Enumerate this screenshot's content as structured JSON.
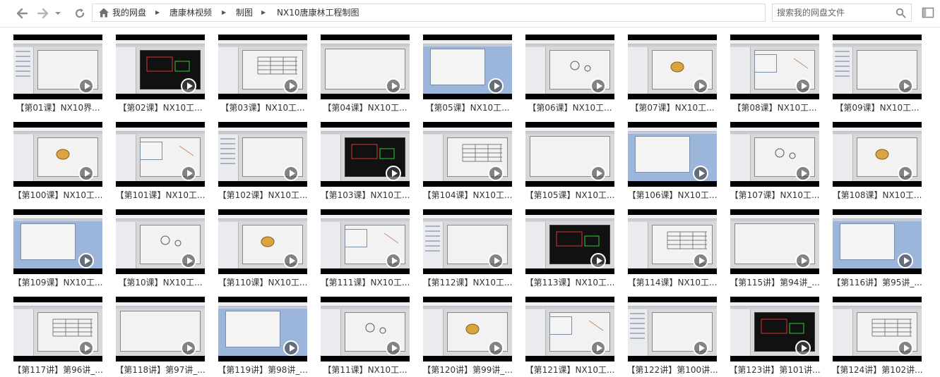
{
  "nav": {
    "back_icon": "back-arrow-icon",
    "forward_icon": "forward-arrow-icon",
    "history_icon": "chevron-down-icon",
    "refresh_icon": "refresh-icon"
  },
  "breadcrumb": {
    "home_icon": "home-icon",
    "items": [
      "我的网盘",
      "唐康林视频",
      "制图",
      "NX10唐康林工程制图"
    ]
  },
  "search": {
    "placeholder": "搜索我的网盘文件",
    "icon": "search-icon"
  },
  "panel_toggle_icon": "panel-toggle-icon",
  "colors": {
    "accent_green": "#1f9f2a",
    "thumb_bg": "#000000",
    "ui_gray": "#d8d8d8"
  },
  "files": [
    {
      "label": "【第01课】NX10界..."
    },
    {
      "label": "【第02课】NX10工..."
    },
    {
      "label": "【第03课】NX10工..."
    },
    {
      "label": "【第04课】NX10工..."
    },
    {
      "label": "【第05课】NX10工..."
    },
    {
      "label": "【第06课】NX10工..."
    },
    {
      "label": "【第07课】NX10工..."
    },
    {
      "label": "【第08课】NX10工..."
    },
    {
      "label": "【第09课】NX10工..."
    },
    {
      "label": "【第100课】NX10工..."
    },
    {
      "label": "【第101课】NX10工..."
    },
    {
      "label": "【第102课】NX10工..."
    },
    {
      "label": "【第103课】NX10工..."
    },
    {
      "label": "【第104课】NX10工..."
    },
    {
      "label": "【第105课】NX10工..."
    },
    {
      "label": "【第106课】NX10工..."
    },
    {
      "label": "【第107课】NX10工..."
    },
    {
      "label": "【第108课】NX10工..."
    },
    {
      "label": "【第109课】NX10工..."
    },
    {
      "label": "【第10课】NX10工..."
    },
    {
      "label": "【第110课】NX10工..."
    },
    {
      "label": "【第111课】NX10工..."
    },
    {
      "label": "【第112课】NX10工..."
    },
    {
      "label": "【第113课】NX10工..."
    },
    {
      "label": "【第114课】NX10工..."
    },
    {
      "label": "【第115讲】第94讲_..."
    },
    {
      "label": "【第116讲】第95讲_..."
    },
    {
      "label": "【第117讲】第96讲_..."
    },
    {
      "label": "【第118讲】第97讲_..."
    },
    {
      "label": "【第119讲】第98讲_..."
    },
    {
      "label": "【第11课】NX10工..."
    },
    {
      "label": "【第120讲】第99讲_..."
    },
    {
      "label": "【第121课】NX10工..."
    },
    {
      "label": "【第122讲】第100讲..."
    },
    {
      "label": "【第123讲】第101讲..."
    },
    {
      "label": "【第124讲】第102讲..."
    }
  ]
}
